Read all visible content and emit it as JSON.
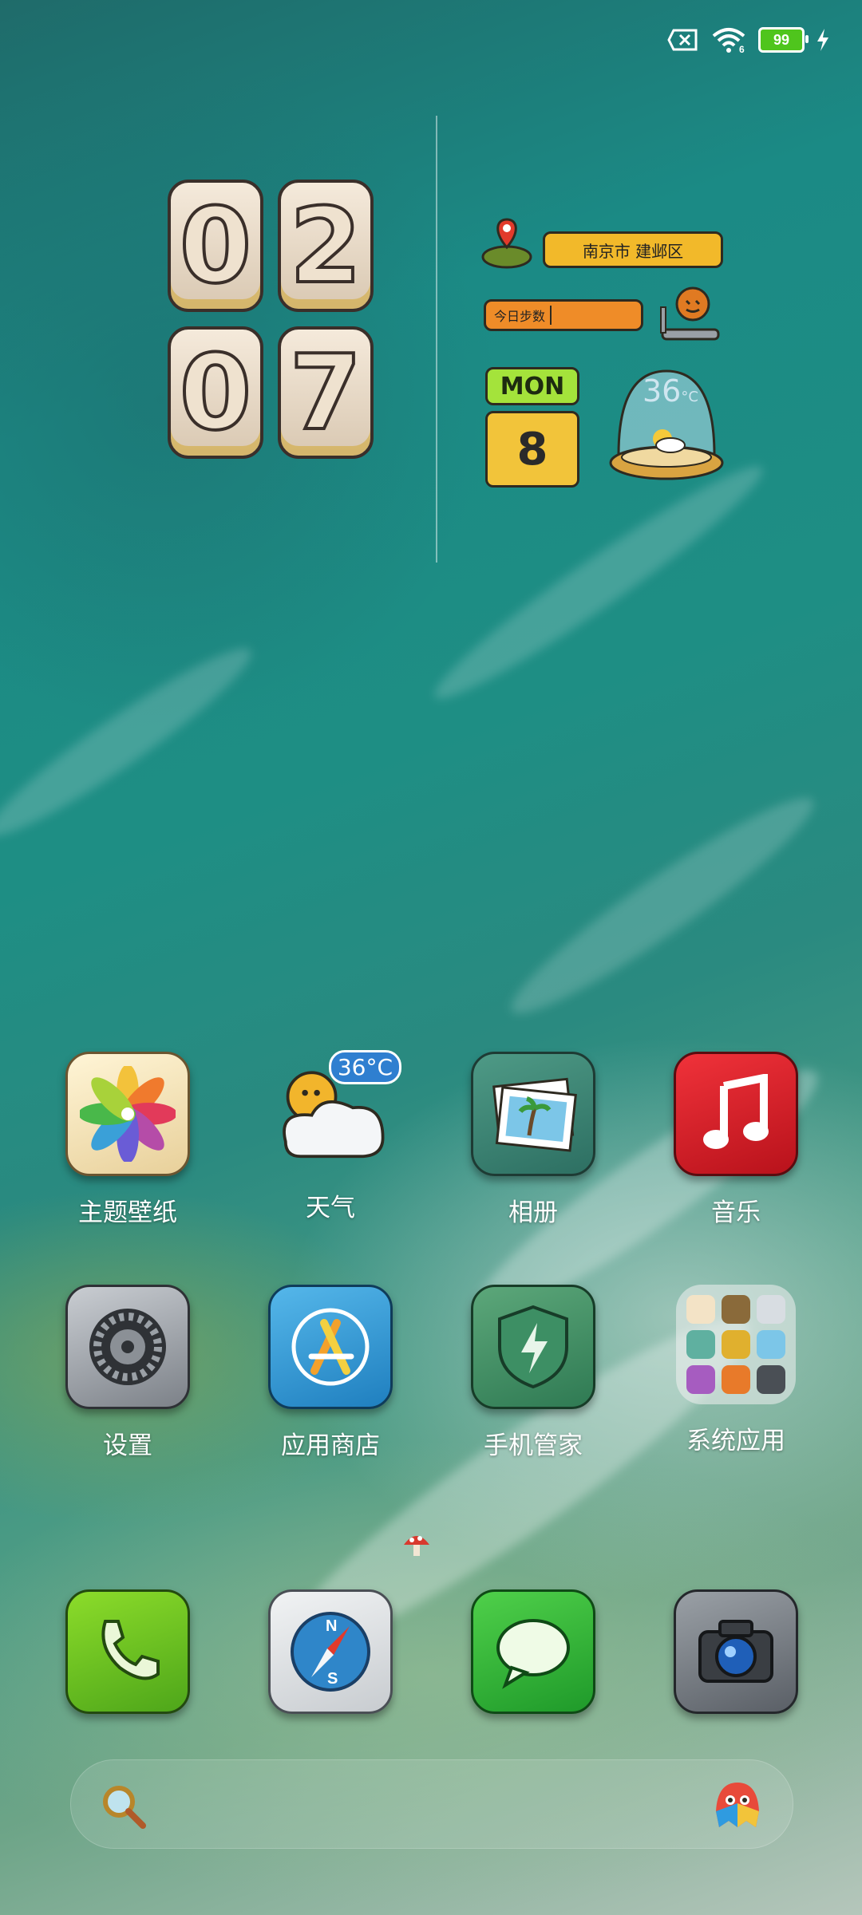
{
  "status_bar": {
    "battery_level": "99",
    "icons": [
      "sim-off-icon",
      "wifi-6-icon",
      "battery-icon",
      "charging-icon"
    ]
  },
  "clock": {
    "hour_digits": [
      "0",
      "2"
    ],
    "minute_digits": [
      "0",
      "7"
    ]
  },
  "info_widget": {
    "location": "南京市 建邺区",
    "steps_label": "今日步数",
    "weekday": "MON",
    "day": "8",
    "temperature": "36",
    "temperature_unit": "°C"
  },
  "apps_row1": [
    {
      "label": "主题壁纸",
      "icon": "theme-wallpaper-icon"
    },
    {
      "label": "天气",
      "icon": "weather-icon",
      "badge": "36°C"
    },
    {
      "label": "相册",
      "icon": "gallery-icon"
    },
    {
      "label": "音乐",
      "icon": "music-icon"
    }
  ],
  "apps_row2": [
    {
      "label": "设置",
      "icon": "settings-icon"
    },
    {
      "label": "应用商店",
      "icon": "app-store-icon"
    },
    {
      "label": "手机管家",
      "icon": "security-icon"
    },
    {
      "label": "系统应用",
      "icon": "system-apps-folder-icon"
    }
  ],
  "dock": [
    {
      "icon": "phone-icon"
    },
    {
      "icon": "browser-compass-icon"
    },
    {
      "icon": "messages-icon"
    },
    {
      "icon": "camera-icon"
    }
  ],
  "search_bar": {
    "icons": [
      "search-icon",
      "assistant-icon"
    ]
  },
  "colors": {
    "battery": "#4fc51d",
    "location_pill": "#f2b92a",
    "steps_pill": "#ef8c28",
    "weekday_badge": "#a4e33b",
    "date_box": "#f2c43a"
  }
}
